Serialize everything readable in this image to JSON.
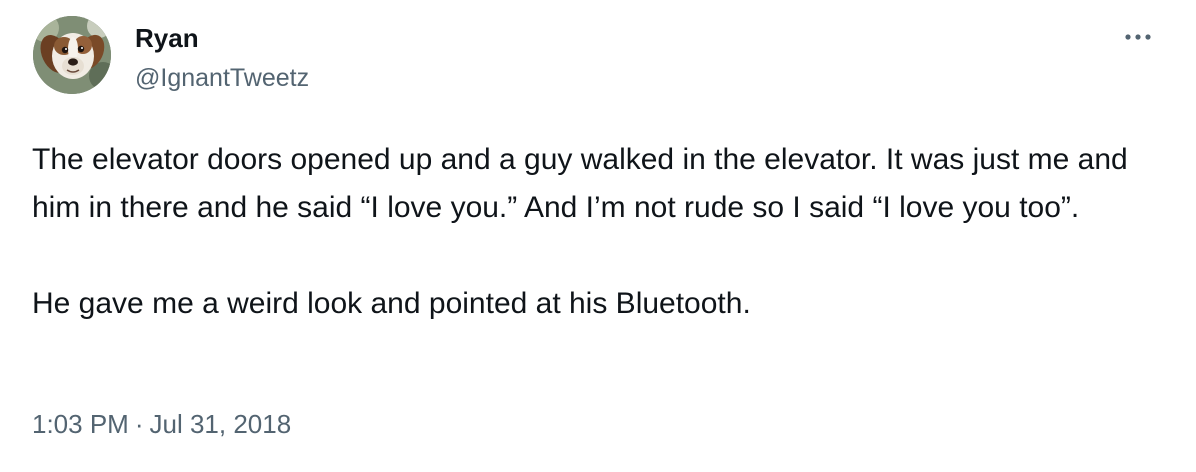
{
  "author": {
    "name": "Ryan",
    "handle": "@IgnantTweetz",
    "avatar_icon": "dog-avatar"
  },
  "menu": {
    "icon": "more-horizontal-icon"
  },
  "tweet": {
    "paragraphs": [
      "The elevator doors opened up and a guy walked in the elevator. It was just me and him in there and he said “I love you.” And I’m not rude so I said “I love you too”.",
      "He gave me a weird look and pointed at his Bluetooth."
    ]
  },
  "meta": {
    "time": "1:03 PM",
    "separator": "·",
    "date": "Jul 31, 2018"
  },
  "colors": {
    "text_primary": "#0f1419",
    "text_secondary": "#536471",
    "background": "#ffffff"
  }
}
